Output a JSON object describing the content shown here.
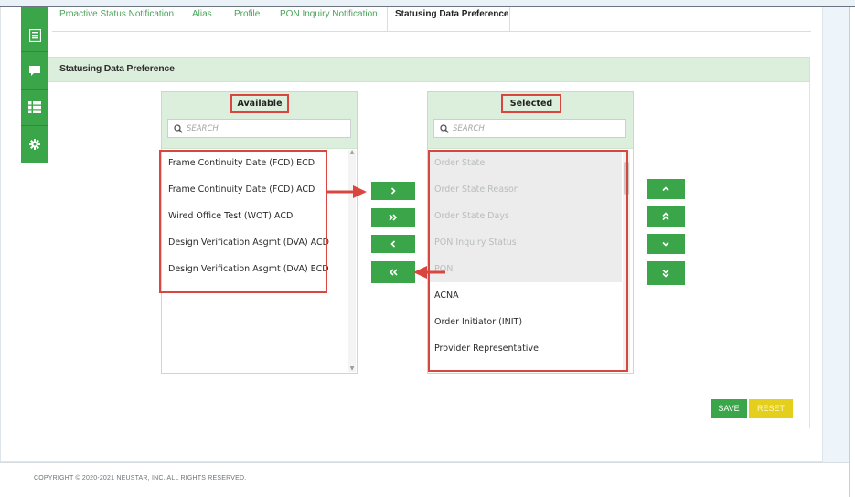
{
  "tabs": [
    {
      "label": "Proactive Status Notification"
    },
    {
      "label": "Alias"
    },
    {
      "label": "Profile"
    },
    {
      "label": "PON Inquiry Notification"
    },
    {
      "label": "Statusing Data Preference"
    }
  ],
  "active_tab": "Statusing Data Preference",
  "sidebar": {
    "items": [
      {
        "icon": "document-list-icon"
      },
      {
        "icon": "chat-bubble-icon"
      },
      {
        "icon": "table-list-icon"
      },
      {
        "icon": "gear-icon"
      }
    ]
  },
  "panel": {
    "title": "Statusing Data Preference"
  },
  "available": {
    "header": "Available",
    "search_placeholder": "SEARCH",
    "items": [
      "Frame Continuity Date (FCD) ECD",
      "Frame Continuity Date (FCD) ACD",
      "Wired Office Test (WOT) ACD",
      "Design Verification Asgmt (DVA) ACD",
      "Design Verification Asgmt (DVA) ECD"
    ]
  },
  "selected": {
    "header": "Selected",
    "search_placeholder": "SEARCH",
    "items": [
      {
        "label": "Order State",
        "disabled": true
      },
      {
        "label": "Order State Reason",
        "disabled": true
      },
      {
        "label": "Order State Days",
        "disabled": true
      },
      {
        "label": "PON Inquiry Status",
        "disabled": true
      },
      {
        "label": "PON",
        "disabled": true
      },
      {
        "label": "ACNA",
        "disabled": false
      },
      {
        "label": "Order Initiator (INIT)",
        "disabled": false
      },
      {
        "label": "Provider Representative",
        "disabled": false
      }
    ]
  },
  "transfer_buttons": [
    {
      "icon": "chevron-right-icon",
      "glyph": "›"
    },
    {
      "icon": "double-chevron-right-icon",
      "glyph": "»"
    },
    {
      "icon": "chevron-left-icon",
      "glyph": "‹"
    },
    {
      "icon": "double-chevron-left-icon",
      "glyph": "«"
    }
  ],
  "order_buttons": [
    {
      "icon": "chevron-up-icon"
    },
    {
      "icon": "double-chevron-up-icon"
    },
    {
      "icon": "chevron-down-icon"
    },
    {
      "icon": "double-chevron-down-icon"
    }
  ],
  "actions": {
    "save_label": "SAVE",
    "reset_label": "RESET"
  },
  "footer": {
    "copyright": "COPYRIGHT © 2020-2021 NEUSTAR, INC. ALL RIGHTS RESERVED."
  },
  "colors": {
    "accent": "#3ba54a",
    "highlight": "#d9463f",
    "reset": "#e4cf1c",
    "header_bg": "#dcefdc"
  }
}
